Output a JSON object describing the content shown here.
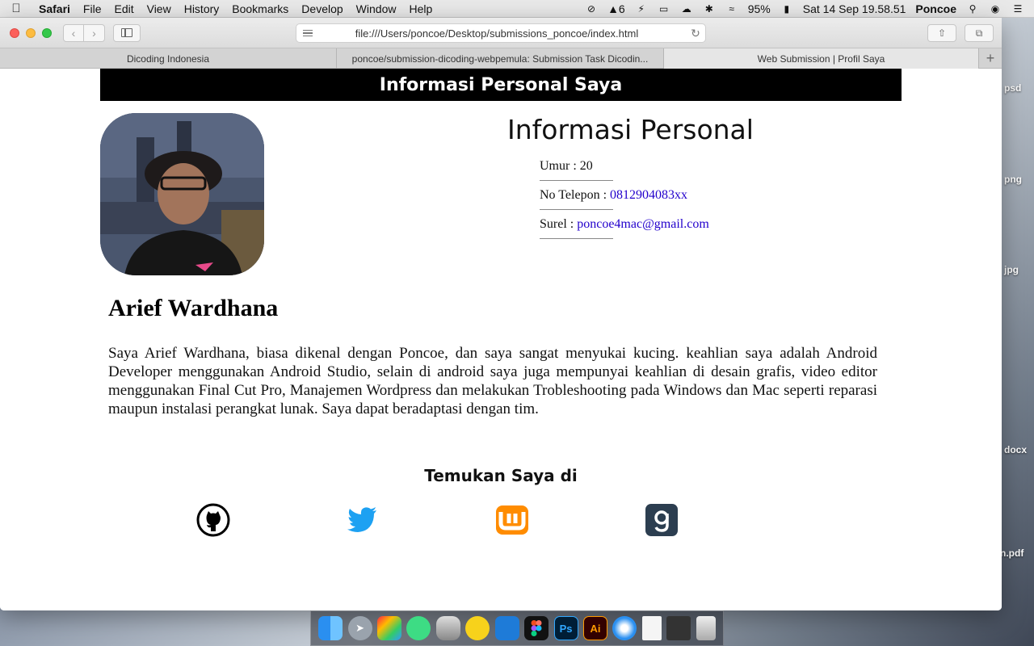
{
  "menubar": {
    "app": "Safari",
    "items": [
      "File",
      "Edit",
      "View",
      "History",
      "Bookmarks",
      "Develop",
      "Window",
      "Help"
    ],
    "status_count": "6",
    "battery": "95%",
    "datetime": "Sat 14 Sep  19.58.51",
    "user": "Poncoe"
  },
  "browser": {
    "url": "file:///Users/poncoe/Desktop/submissions_poncoe/index.html",
    "tabs": [
      {
        "title": "Dicoding Indonesia"
      },
      {
        "title": "poncoe/submission-dicoding-webpemula: Submission Task Dicodin..."
      },
      {
        "title": "Web Submission | Profil Saya"
      }
    ],
    "new_tab_label": "+"
  },
  "page": {
    "header": "Informasi Personal Saya",
    "info_title": "Informasi Personal",
    "info": {
      "age_label": "Umur : ",
      "age_value": "20",
      "phone_label": "No Telepon : ",
      "phone_value": "0812904083xx",
      "email_label": "Surel : ",
      "email_value": "poncoe4mac@gmail.com"
    },
    "name": "Arief Wardhana",
    "bio": "Saya Arief Wardhana, biasa dikenal dengan Poncoe, dan saya sangat menyukai kucing. keahlian saya adalah Android Developer menggunakan Android Studio, selain di android saya juga mempunyai keahlian di desain grafis, video editor menggunakan Final Cut Pro, Manajemen Wordpress dan melakukan Trobleshooting pada Windows dan Mac seperti reparasi maupun instalasi perangkat lunak. Saya dapat beradaptasi dengan tim.",
    "find_title": "Temukan Saya di",
    "social": [
      {
        "icon": "github-icon",
        "color": "#000000"
      },
      {
        "icon": "twitter-icon",
        "color": "#1da1f2"
      },
      {
        "icon": "wattpad-icon",
        "color": "#ff8c00"
      },
      {
        "icon": "goodreads-icon",
        "color": "#2c3e50"
      }
    ]
  },
  "desktop": {
    "file_labels": [
      "psd",
      "png",
      "jpg",
      "docx",
      "n.pdf"
    ]
  },
  "dock": {
    "apps": [
      "Finder",
      "Launchpad",
      "Final Cut Pro",
      "Android Studio",
      "Sequel Pro",
      "Cyberduck",
      "Visual Studio Code",
      "Figma",
      "Photoshop",
      "Illustrator",
      "Safari",
      "Documents",
      "Downloads",
      "Trash"
    ],
    "ps_label": "Ps",
    "ai_label": "Ai"
  }
}
